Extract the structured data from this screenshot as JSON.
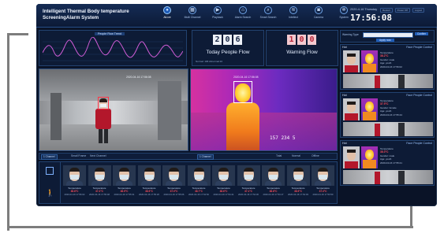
{
  "app": {
    "title_line1": "Intelligent Thermal Body temperature",
    "title_line2": "ScreeningAlarm System"
  },
  "nav": [
    {
      "label": "AiLive",
      "icon": "live-icon",
      "active": true
    },
    {
      "label": "Multi Channel",
      "icon": "grid-icon",
      "active": false
    },
    {
      "label": "Playback",
      "icon": "playback-icon",
      "active": false
    },
    {
      "label": "Alarm Search",
      "icon": "alarm-icon",
      "active": false
    },
    {
      "label": "Smart Search",
      "icon": "search-icon",
      "active": false
    },
    {
      "label": "Intellect",
      "icon": "wifi-icon",
      "active": false
    },
    {
      "label": "Camera",
      "icon": "camera-icon",
      "active": false
    },
    {
      "label": "System",
      "icon": "gear-icon",
      "active": false
    }
  ],
  "header_right": {
    "date": "2020-4-16  Thursday",
    "time": "17:56:08",
    "buttons": [
      "Restart",
      "Power Off",
      "Logout"
    ]
  },
  "trend": {
    "title": "People Flow Trend"
  },
  "today_flow": {
    "digits": [
      "2",
      "0",
      "6"
    ],
    "label": "Today People Flow",
    "sub": "Normal: 196  Abnormal:10"
  },
  "warning_flow": {
    "digits": [
      "1",
      "0",
      "0"
    ],
    "label": "Warning Flow"
  },
  "cameras": {
    "visible_label": "Visible",
    "thermal_label": "Thermal",
    "visible_timestamp": "2020-04-16 17:56:08",
    "thermal_timestamp": "2020-04-16 17:56:08",
    "thermal_id": "157 234 5"
  },
  "controls": {
    "channel1": "1 Channel",
    "channel2": "1 Channel",
    "small_frame": "Small Frame",
    "next_channel": "Next Channel",
    "total": "Total",
    "normal": "Normal",
    "abnormal": "Offline"
  },
  "capture_cards": [
    {
      "label": "Temperature",
      "value": "36.8°C",
      "time": "2020-04-16 17:56:02"
    },
    {
      "label": "Temperature",
      "value": "37.2°C",
      "time": "2020-04-16 17:55:48"
    },
    {
      "label": "Temperature",
      "value": "36.5°C",
      "time": "2020-04-16 17:55:31"
    },
    {
      "label": "Temperature",
      "value": "36.9°C",
      "time": "2020-04-16 17:55:20"
    },
    {
      "label": "Temperature",
      "value": "37.0°C",
      "time": "2020-04-16 17:55:06"
    },
    {
      "label": "Temperature",
      "value": "36.7°C",
      "time": "2020-04-16 17:54:52"
    },
    {
      "label": "Temperature",
      "value": "36.6°C",
      "time": "2020-04-16 17:54:41"
    },
    {
      "label": "Temperature",
      "value": "37.1°C",
      "time": "2020-04-16 17:54:30"
    },
    {
      "label": "Temperature",
      "value": "36.8°C",
      "time": "2020-04-16 17:54:17"
    },
    {
      "label": "Temperature",
      "value": "36.9°C",
      "time": "2020-04-16 17:54:03"
    },
    {
      "label": "Temperature",
      "value": "37.3°C",
      "time": "2020-04-16 17:53:50"
    }
  ],
  "search": {
    "label": "Warning Type",
    "button": "Confirm",
    "apply": "Apply now"
  },
  "records": [
    {
      "status": "Hot",
      "type": "Face People Control",
      "temp_label": "Temperature",
      "temp": "38.2°C",
      "gender": "Gender: male",
      "age": "Age: youth",
      "time": "2020-04-16 17:56:02"
    },
    {
      "status": "Hot",
      "type": "Face People Control",
      "temp_label": "Temperature",
      "temp": "37.9°C",
      "gender": "Gender: female",
      "age": "Age: youth",
      "time": "2020-04-16 17:55:44"
    },
    {
      "status": "Hot",
      "type": "Face People Control",
      "temp_label": "Temperature",
      "temp": "38.0°C",
      "gender": "Gender: male",
      "age": "Age: youth",
      "time": "2020-04-16 17:55:21"
    }
  ],
  "colors": {
    "background": "#0a1327",
    "accent": "#1f5cb6",
    "alarm": "#ff4d5b",
    "frame": "#7d7d7d"
  }
}
